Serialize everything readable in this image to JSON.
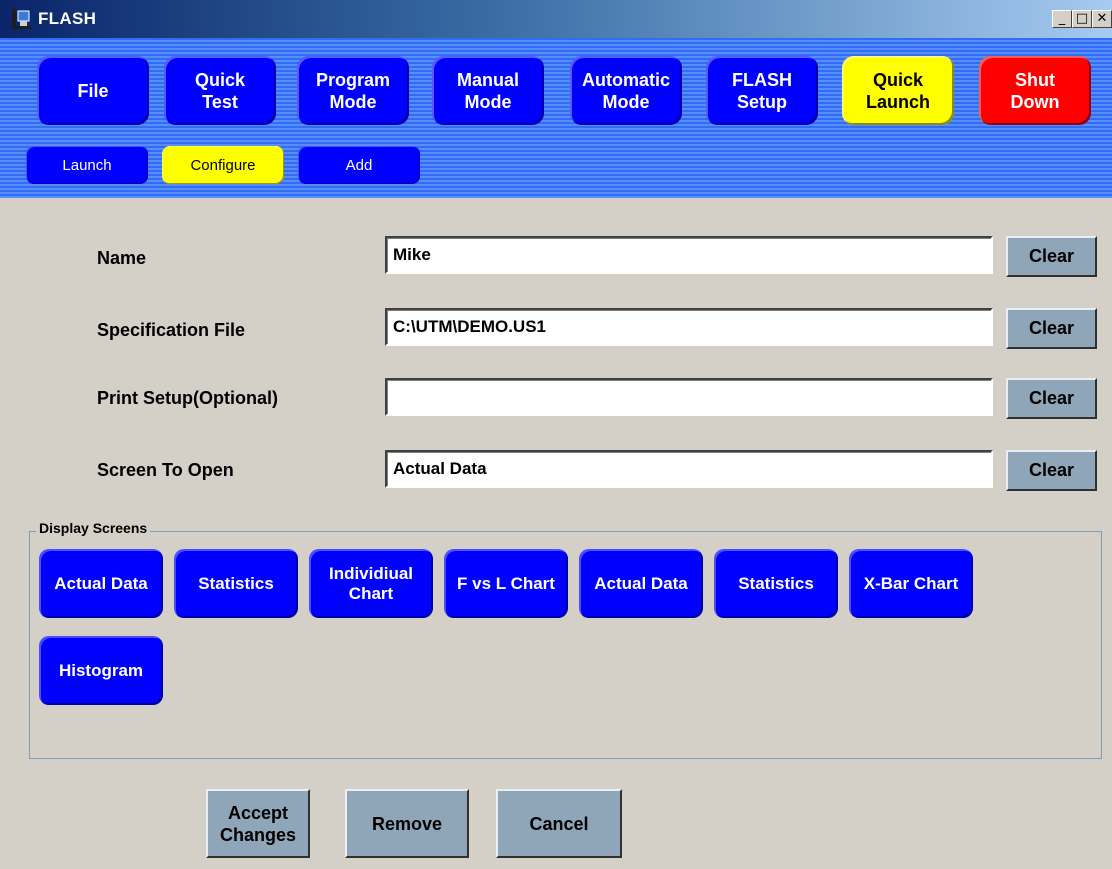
{
  "window": {
    "title": "FLASH",
    "min_glyph": "_",
    "max_glyph": "□",
    "close_glyph": "✕",
    "icon": "flash-app-icon"
  },
  "top_menu": [
    {
      "label": "File",
      "color": "blue"
    },
    {
      "label": "Quick\nTest",
      "color": "blue"
    },
    {
      "label": "Program\nMode",
      "color": "blue"
    },
    {
      "label": "Manual\nMode",
      "color": "blue"
    },
    {
      "label": "Automatic\nMode",
      "color": "blue"
    },
    {
      "label": "FLASH\nSetup",
      "color": "blue"
    },
    {
      "label": "Quick\nLaunch",
      "color": "yellow"
    },
    {
      "label": "Shut\nDown",
      "color": "red"
    }
  ],
  "sub_menu": [
    {
      "label": "Launch",
      "color": "blue"
    },
    {
      "label": "Configure",
      "color": "yellow"
    },
    {
      "label": "Add",
      "color": "blue"
    }
  ],
  "form": {
    "name_label": "Name",
    "name_value": "Mike",
    "spec_label": "Specification File",
    "spec_value": "C:\\UTM\\DEMO.US1",
    "print_label": "Print Setup(Optional)",
    "print_value": "",
    "screen_label": "Screen To Open",
    "screen_value": "Actual Data",
    "clear_label": "Clear"
  },
  "display_screens": {
    "group_label": "Display Screens",
    "buttons": [
      "Actual Data",
      "Statistics",
      "Individiual\nChart",
      "F vs L Chart",
      "Actual Data",
      "Statistics",
      "X-Bar Chart",
      "Histogram"
    ]
  },
  "actions": {
    "accept": "Accept\nChanges",
    "remove": "Remove",
    "cancel": "Cancel"
  },
  "colors": {
    "button_blue": "#0000ff",
    "highlight_yellow": "#ffff00",
    "shutdown_red": "#ff0000",
    "band_blue": "#2f6df5",
    "gray_button": "#8fa5b8"
  }
}
